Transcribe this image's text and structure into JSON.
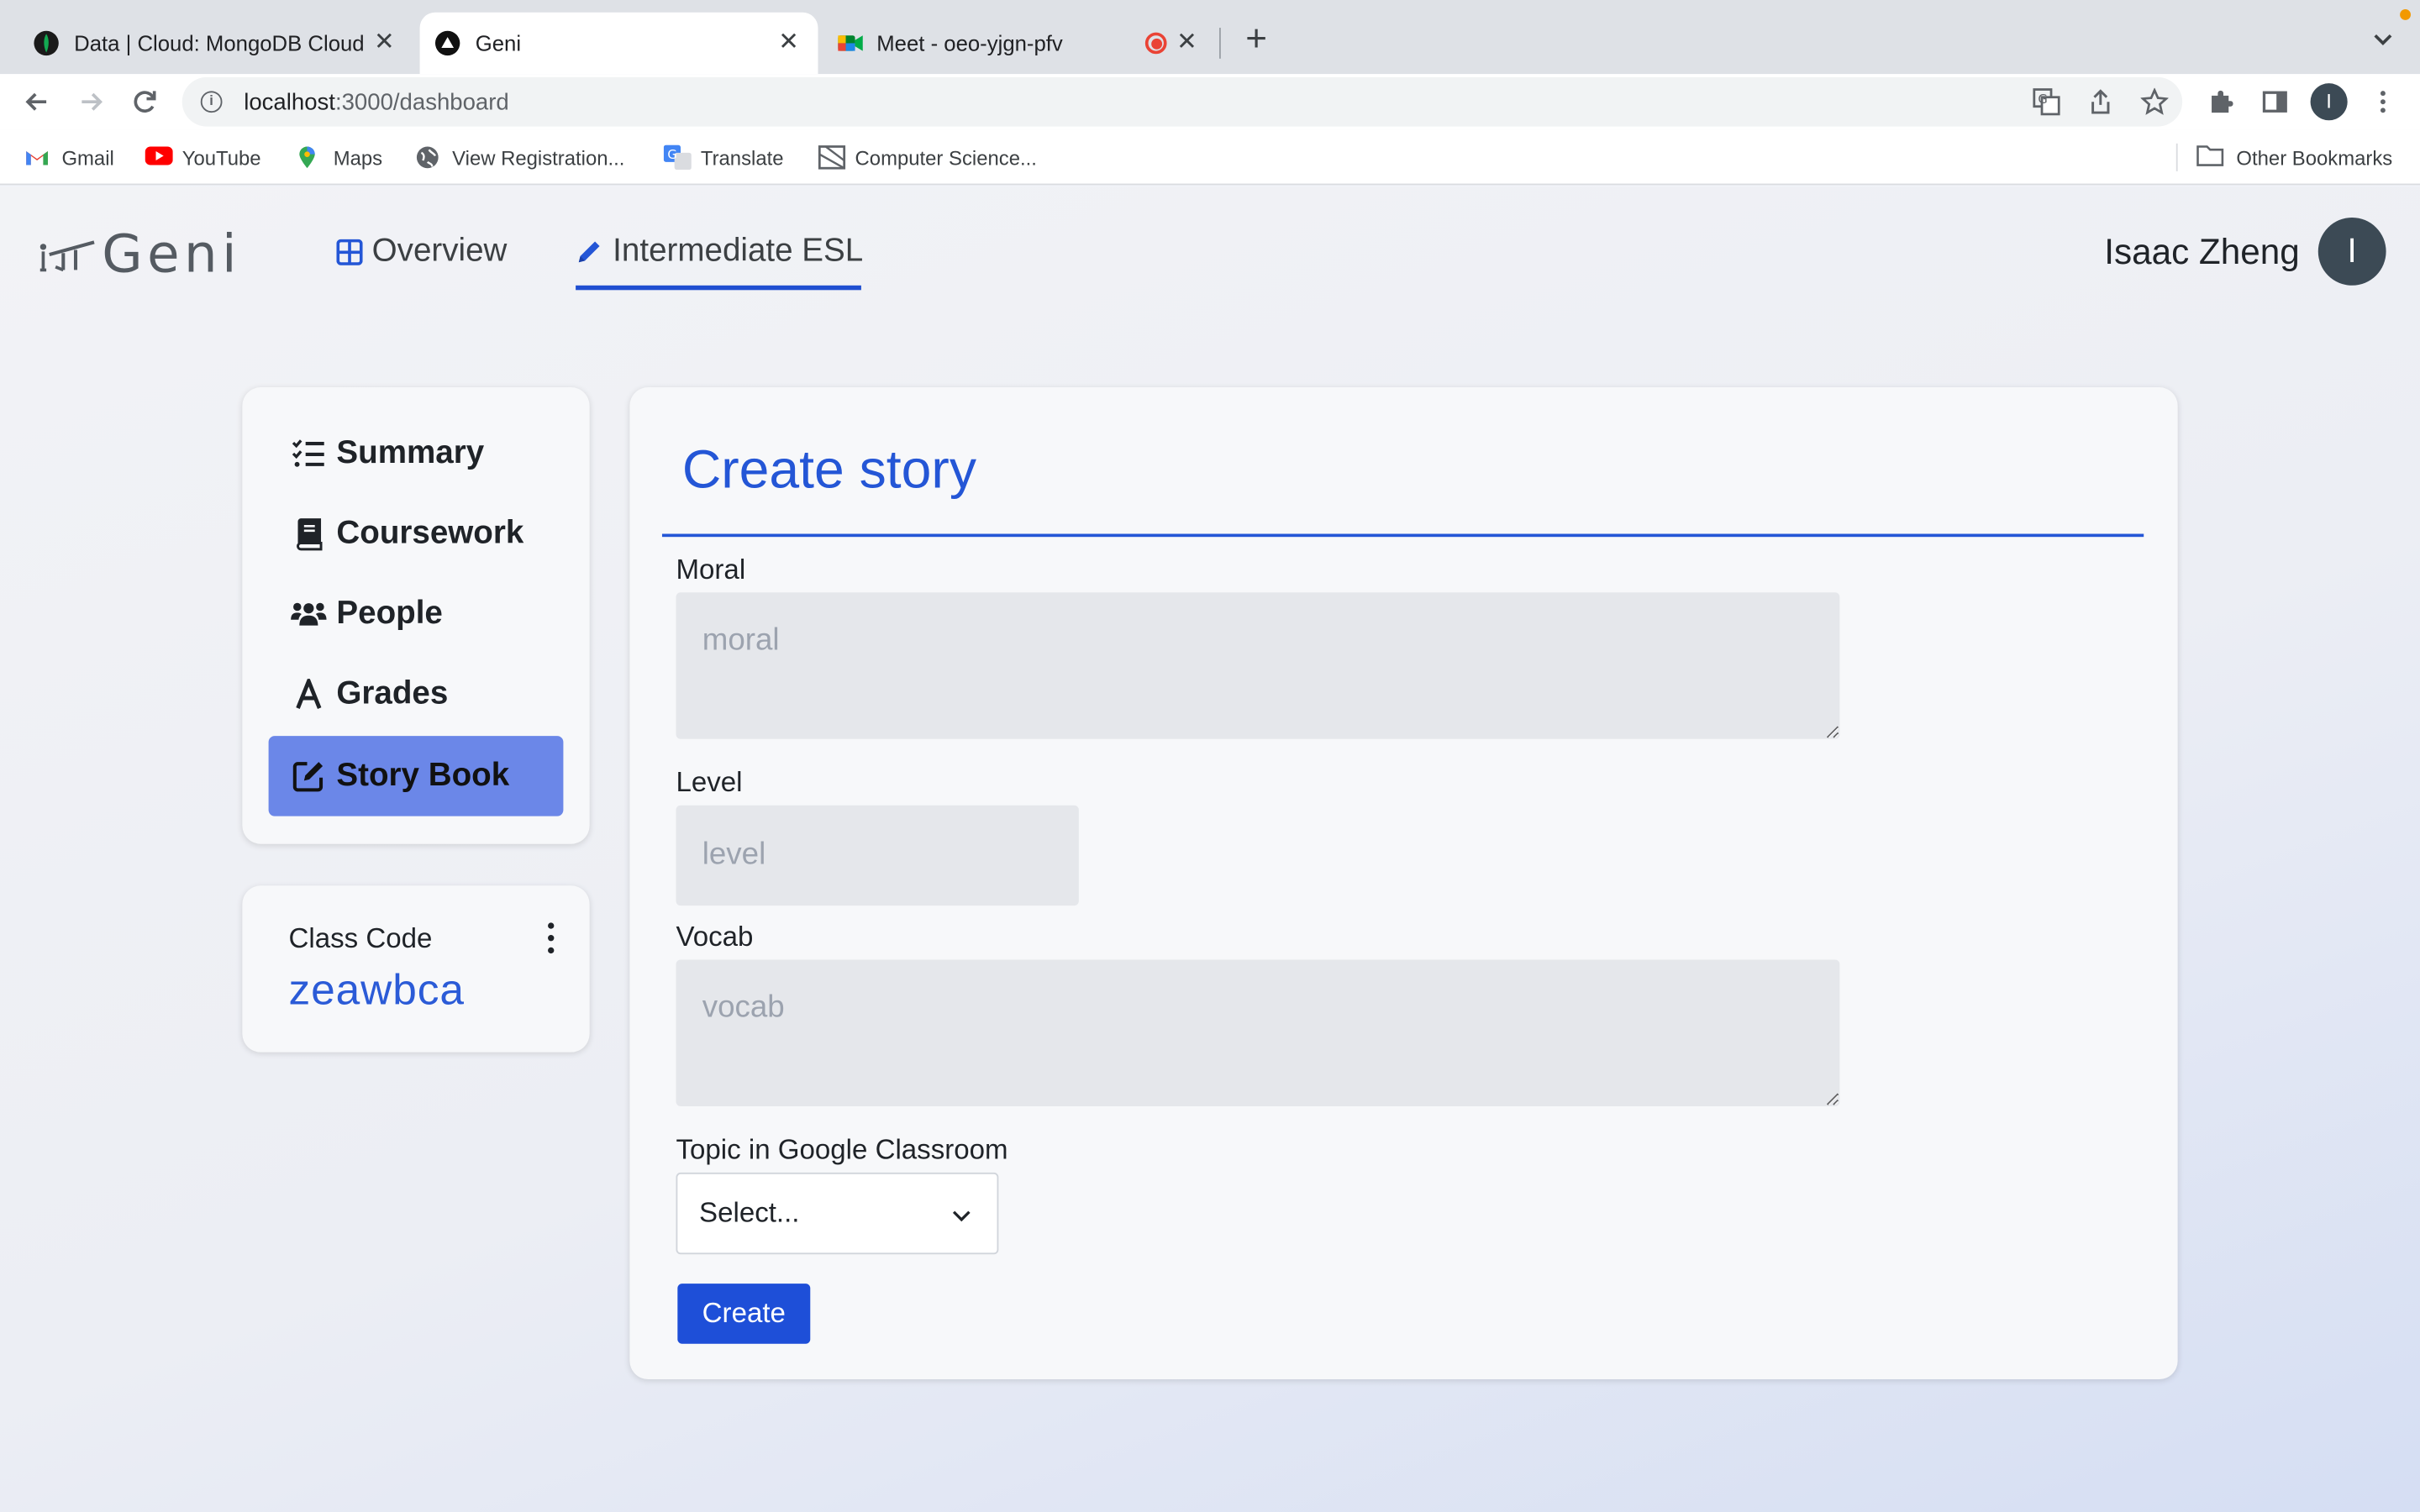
{
  "browser": {
    "tabs": [
      {
        "title": "Data | Cloud: MongoDB Cloud",
        "icon": "mongodb-leaf-icon",
        "active": false
      },
      {
        "title": "Geni",
        "icon": "geni-triangle-icon",
        "active": true
      },
      {
        "title": "Meet - oeo-yjgn-pfv",
        "icon": "google-meet-icon",
        "active": false,
        "recording": true
      }
    ],
    "url_host": "localhost",
    "url_path": ":3000/dashboard",
    "profile_initial": "I",
    "bookmarks": [
      {
        "label": "Gmail",
        "icon": "gmail-icon"
      },
      {
        "label": "YouTube",
        "icon": "youtube-icon"
      },
      {
        "label": "Maps",
        "icon": "maps-pin-icon"
      },
      {
        "label": "View Registration...",
        "icon": "globe-icon"
      },
      {
        "label": "Translate",
        "icon": "translate-icon"
      },
      {
        "label": "Computer Science...",
        "icon": "bookmark-page-icon"
      }
    ],
    "other_bookmarks": "Other Bookmarks"
  },
  "app": {
    "logo_text": "Geni",
    "nav": [
      {
        "label": "Overview",
        "icon": "grid-icon"
      },
      {
        "label": "Intermediate ESL",
        "icon": "pencil-icon",
        "active": true
      }
    ],
    "user": {
      "name": "Isaac Zheng",
      "initial": "I"
    }
  },
  "sidebar": {
    "items": [
      {
        "label": "Summary",
        "icon": "checklist-icon"
      },
      {
        "label": "Coursework",
        "icon": "book-icon"
      },
      {
        "label": "People",
        "icon": "people-icon"
      },
      {
        "label": "Grades",
        "icon": "letter-a-icon"
      },
      {
        "label": "Story Book",
        "icon": "edit-square-icon",
        "active": true
      }
    ]
  },
  "class_code": {
    "label": "Class Code",
    "value": "zeawbca"
  },
  "form": {
    "title": "Create story",
    "moral": {
      "label": "Moral",
      "placeholder": "moral",
      "value": ""
    },
    "level": {
      "label": "Level",
      "placeholder": "level",
      "value": ""
    },
    "vocab": {
      "label": "Vocab",
      "placeholder": "vocab",
      "value": ""
    },
    "topic": {
      "label": "Topic in Google Classroom",
      "selected": "Select..."
    },
    "submit_label": "Create"
  },
  "colors": {
    "accent": "#2456d6",
    "active_sidebar": "#6b87e8",
    "button": "#1e4fd8"
  }
}
